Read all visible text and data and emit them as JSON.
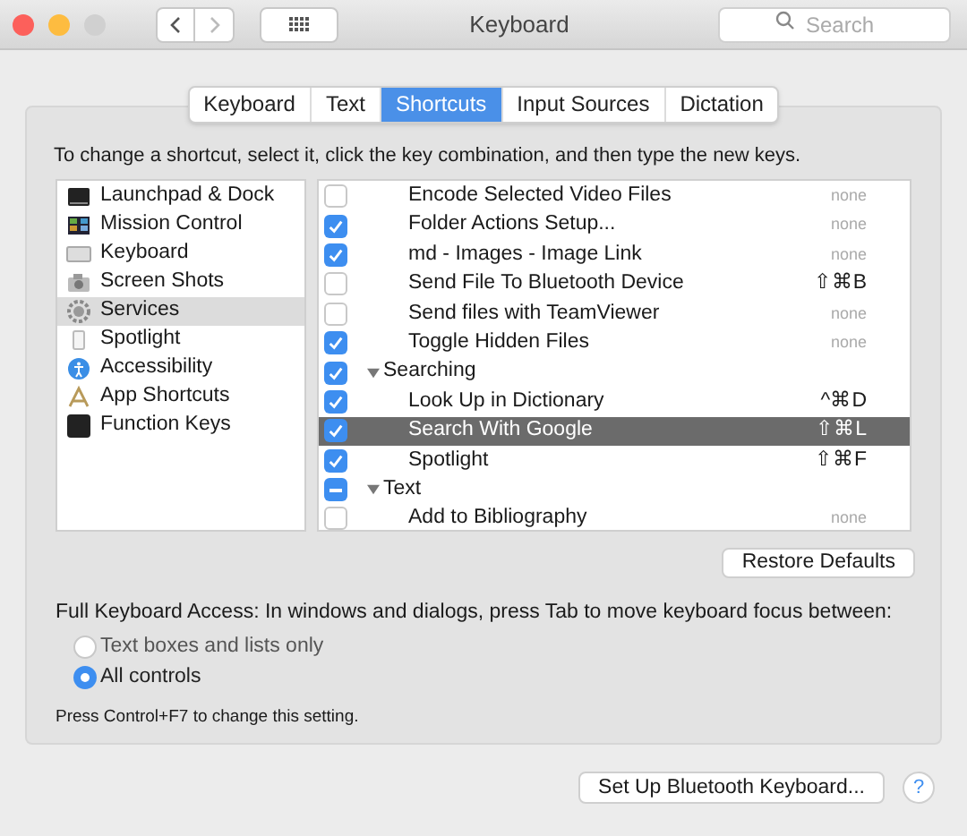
{
  "window": {
    "title": "Keyboard",
    "search": {
      "placeholder": "Search"
    }
  },
  "tabs": [
    {
      "label": "Keyboard",
      "selected": false
    },
    {
      "label": "Text",
      "selected": false
    },
    {
      "label": "Shortcuts",
      "selected": true
    },
    {
      "label": "Input Sources",
      "selected": false
    },
    {
      "label": "Dictation",
      "selected": false
    }
  ],
  "instruction": "To change a shortcut, select it, click the key combination, and then type the new keys.",
  "categories": [
    {
      "label": "Launchpad & Dock",
      "selected": false
    },
    {
      "label": "Mission Control",
      "selected": false
    },
    {
      "label": "Keyboard",
      "selected": false
    },
    {
      "label": "Screen Shots",
      "selected": false
    },
    {
      "label": "Services",
      "selected": true
    },
    {
      "label": "Spotlight",
      "selected": false
    },
    {
      "label": "Accessibility",
      "selected": false
    },
    {
      "label": "App Shortcuts",
      "selected": false
    },
    {
      "label": "Function Keys",
      "selected": false
    }
  ],
  "shortcuts": [
    {
      "kind": "item",
      "label": "Encode Selected Video Files",
      "keys": "none",
      "checked": false,
      "selected": false
    },
    {
      "kind": "item",
      "label": "Folder Actions Setup...",
      "keys": "none",
      "checked": true,
      "selected": false
    },
    {
      "kind": "item",
      "label": "md - Images - Image Link",
      "keys": "none",
      "checked": true,
      "selected": false
    },
    {
      "kind": "item",
      "label": "Send File To Bluetooth Device",
      "keys": "⇧⌘B",
      "checked": false,
      "selected": false
    },
    {
      "kind": "item",
      "label": "Send files with TeamViewer",
      "keys": "none",
      "checked": false,
      "selected": false
    },
    {
      "kind": "item",
      "label": "Toggle Hidden Files",
      "keys": "none",
      "checked": true,
      "selected": false
    },
    {
      "kind": "group",
      "label": "Searching",
      "checked": true,
      "mixed": false,
      "expanded": true,
      "selected": false
    },
    {
      "kind": "item",
      "label": "Look Up in Dictionary",
      "keys": "^⌘D",
      "checked": true,
      "selected": false
    },
    {
      "kind": "item",
      "label": "Search With Google",
      "keys": "⇧⌘L",
      "checked": true,
      "selected": true
    },
    {
      "kind": "item",
      "label": "Spotlight",
      "keys": "⇧⌘F",
      "checked": true,
      "selected": false
    },
    {
      "kind": "group",
      "label": "Text",
      "checked": true,
      "mixed": true,
      "expanded": true,
      "selected": false
    },
    {
      "kind": "item",
      "label": "Add to Bibliography",
      "keys": "none",
      "checked": false,
      "selected": false
    }
  ],
  "restore_button": "Restore Defaults",
  "keyboard_access": {
    "label": "Full Keyboard Access: In windows and dialogs, press Tab to move keyboard focus between:",
    "options": [
      {
        "label": "Text boxes and lists only",
        "selected": false
      },
      {
        "label": "All controls",
        "selected": true
      }
    ],
    "hint": "Press Control+F7 to change this setting."
  },
  "bluetooth_button": "Set Up Bluetooth Keyboard...",
  "help_button": "?"
}
